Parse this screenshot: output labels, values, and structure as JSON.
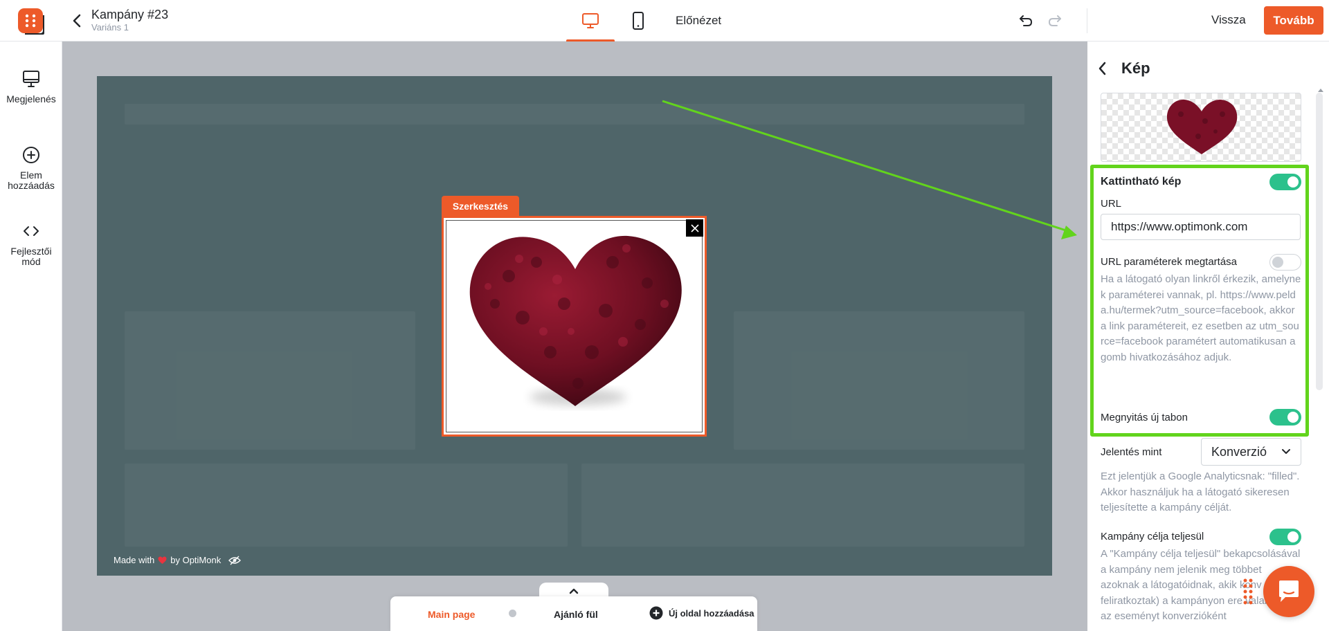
{
  "header": {
    "campaign_title": "Kampány #23",
    "variant": "Variáns 1",
    "preview_label": "Előnézet",
    "back_label": "Vissza",
    "next_label": "Tovább"
  },
  "sidebar": {
    "items": [
      {
        "label": "Megjelenés",
        "icon": "monitor-icon"
      },
      {
        "label": "Elem hozzáadás",
        "icon": "plus-circle-icon"
      },
      {
        "label": "Fejlesztői mód",
        "icon": "code-icon"
      }
    ]
  },
  "canvas": {
    "edit_label": "Szerkesztés",
    "made_with_prefix": "Made with",
    "made_with_suffix": "by OptiMonk"
  },
  "pages": {
    "main_page": "Main page",
    "recommend_tab": "Ajánló fül",
    "add_page": "Új oldal hozzáadása"
  },
  "panel": {
    "title": "Kép",
    "clickable_image_label": "Kattintható kép",
    "clickable_image_on": true,
    "url_label": "URL",
    "url_value": "https://www.optimonk.com",
    "keep_params_label": "URL paraméterek megtartása",
    "keep_params_on": false,
    "keep_params_help": "Ha a látogató olyan linkről érkezik, amelynek paraméterei vannak, pl. https://www.pelda.hu/termek?utm_source=facebook, akkor a link paramétereit, ez esetben az utm_source=facebook paramétert automatikusan a gomb hivatkozásához adjuk.",
    "new_tab_label": "Megnyitás új tabon",
    "new_tab_on": true,
    "report_as_label": "Jelentés mint",
    "report_as_value": "Konverzió",
    "report_help": "Ezt jelentjük a Google Analyticsnak: \"filled\". Akkor használjuk ha a látogató sikeresen teljesítette a kampány célját.",
    "goal_label": "Kampány célja teljesül",
    "goal_on": true,
    "goal_help": "A \"Kampány célja teljesül\" bekapcsolásával a kampány nem jelenik meg többet azoknak a látogatóidnak, akik konv (pl. feliratkoztak) a kampányon ere valamint ezt az eseményt konverzióként"
  },
  "colors": {
    "brand": "#ed5a29",
    "toggle_on": "#2cc18c",
    "highlight": "#62d41c",
    "stage_bg": "#4f6569"
  }
}
